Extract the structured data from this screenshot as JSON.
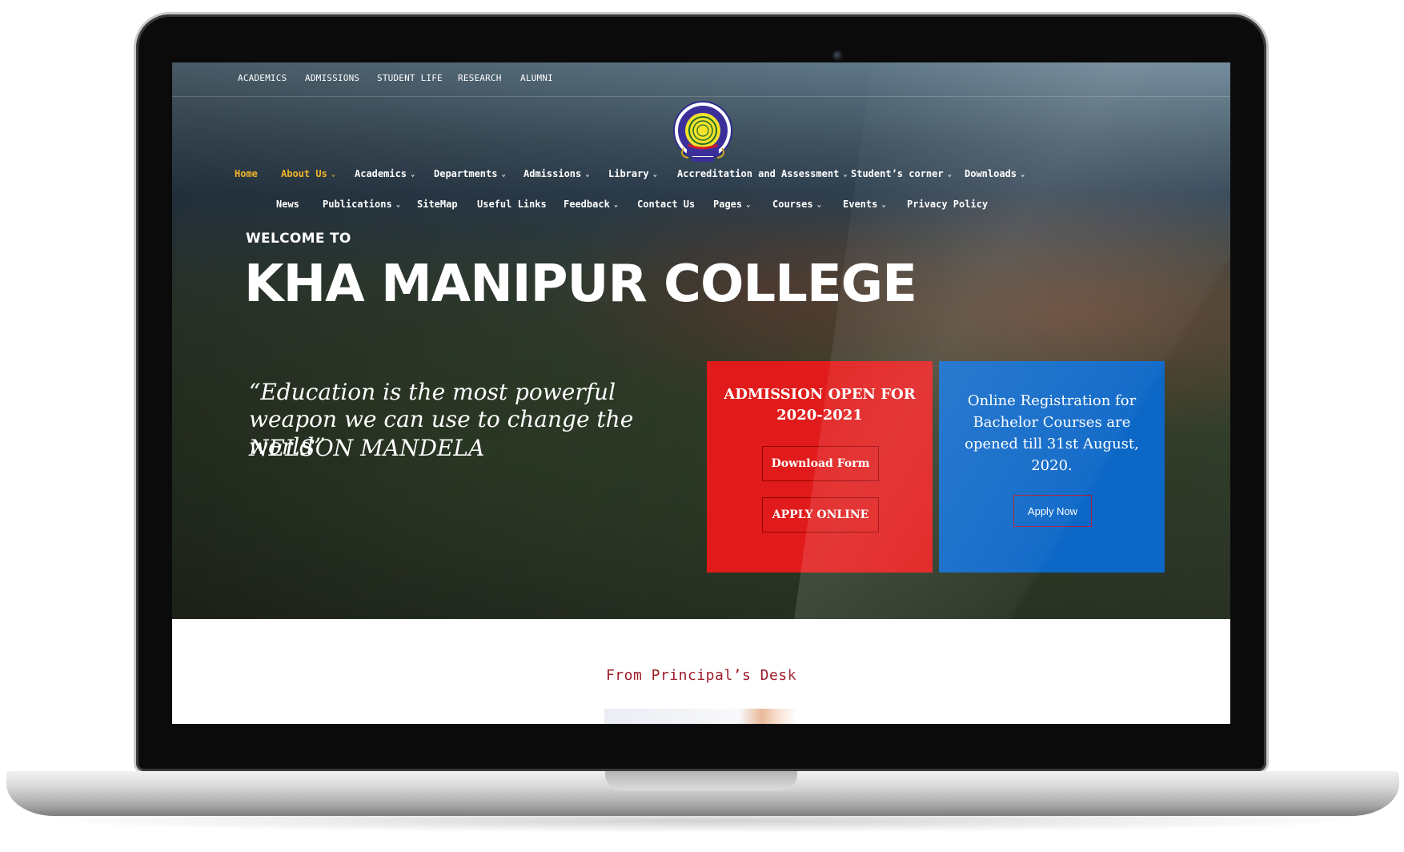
{
  "topbar": {
    "items": [
      "ACADEMICS",
      "ADMISSIONS",
      "STUDENT LIFE",
      "RESEARCH",
      "ALUMNI"
    ]
  },
  "logo": {
    "ring_text": "KHA MANIPUR COLLEGE KAKCHING",
    "center_text": "MANIPUR",
    "motto": "EDUCATION IS LIGHT",
    "estd": "Estd. 1964"
  },
  "nav": {
    "row1": [
      {
        "label": "Home",
        "dropdown": false,
        "active": true
      },
      {
        "label": "About Us",
        "dropdown": true,
        "active": true
      },
      {
        "label": "Academics",
        "dropdown": true
      },
      {
        "label": "Departments",
        "dropdown": true
      },
      {
        "label": "Admissions",
        "dropdown": true
      },
      {
        "label": "Library",
        "dropdown": true
      },
      {
        "label": "Accreditation and Assessment",
        "dropdown": true
      },
      {
        "label": "Student’s corner",
        "dropdown": true
      },
      {
        "label": "Downloads",
        "dropdown": true
      }
    ],
    "row2": [
      {
        "label": "News",
        "dropdown": false
      },
      {
        "label": "Publications",
        "dropdown": true
      },
      {
        "label": "SiteMap",
        "dropdown": false
      },
      {
        "label": "Useful Links",
        "dropdown": false
      },
      {
        "label": "Feedback",
        "dropdown": true
      },
      {
        "label": "Contact Us",
        "dropdown": false
      },
      {
        "label": "Pages",
        "dropdown": true
      },
      {
        "label": "Courses",
        "dropdown": true
      },
      {
        "label": "Events",
        "dropdown": true
      },
      {
        "label": "Privacy Policy",
        "dropdown": false
      }
    ]
  },
  "hero": {
    "welcome": "WELCOME TO",
    "title": "KHA MANIPUR COLLEGE",
    "quote": "“Education is the most powerful weapon we can use to change the world”",
    "author": "NELSON MANDELA"
  },
  "admission_card": {
    "title_line1": "ADMISSION OPEN FOR",
    "title_line2": "2020-2021",
    "download_label": "Download Form",
    "apply_label": "APPLY ONLINE",
    "color": "#e11b1b"
  },
  "registration_card": {
    "text": "Online Registration for Bachelor Courses are opened till 31st August, 2020.",
    "button_label": "Apply Now",
    "color": "#0c67c7"
  },
  "section": {
    "heading": "From Principal’s Desk"
  },
  "colors": {
    "active_nav": "#f0b429",
    "heading_accent": "#9b1c2a"
  }
}
